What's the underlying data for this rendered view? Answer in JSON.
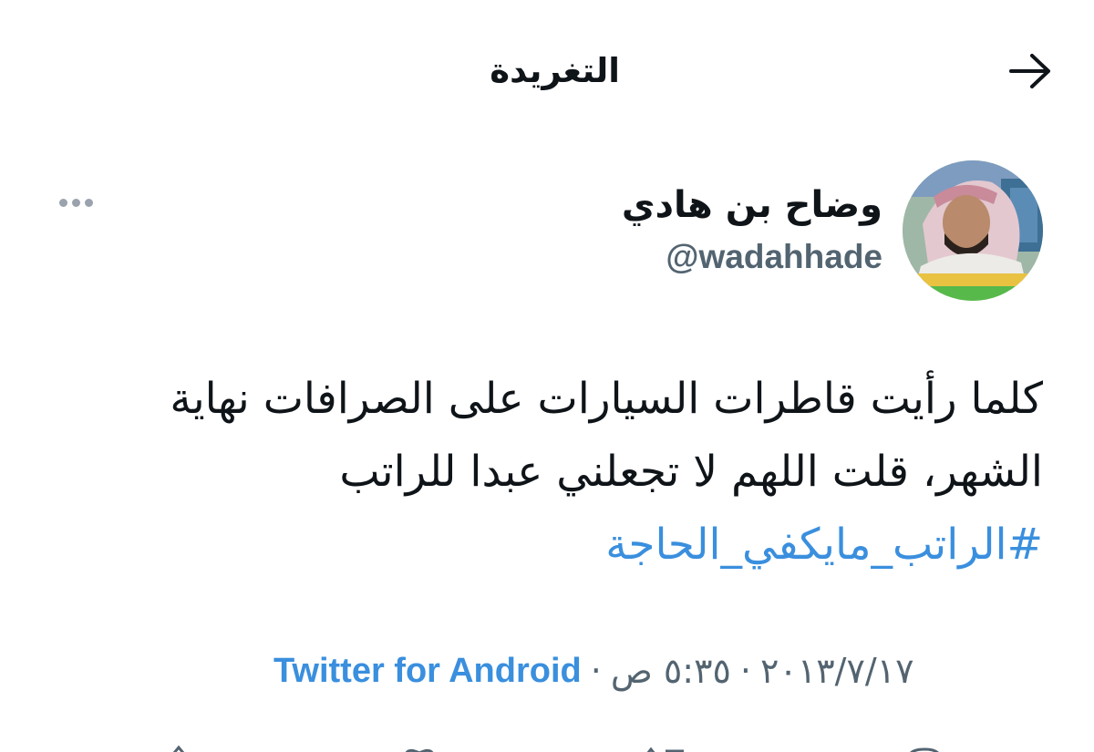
{
  "header": {
    "title": "التغريدة",
    "back_icon": "arrow-right-icon"
  },
  "author": {
    "display_name": "وضاح بن هادي",
    "handle": "@wadahhade",
    "more_icon": "more-horizontal-icon"
  },
  "tweet": {
    "line1": "كلما رأيت قاطرات السيارات على الصرافات نهاية",
    "line2": "الشهر، قلت اللهم لا تجعلني عبدا للراتب",
    "hashtag": "#الراتب_مايكفي_الحاجة"
  },
  "meta": {
    "date": "٢٠١٣/٧/١٧",
    "time": "٥:٣٥ ص",
    "separator": "·",
    "source": "Twitter for Android"
  },
  "colors": {
    "link": "#3a8fde",
    "secondary": "#536471",
    "text": "#0f1419"
  }
}
